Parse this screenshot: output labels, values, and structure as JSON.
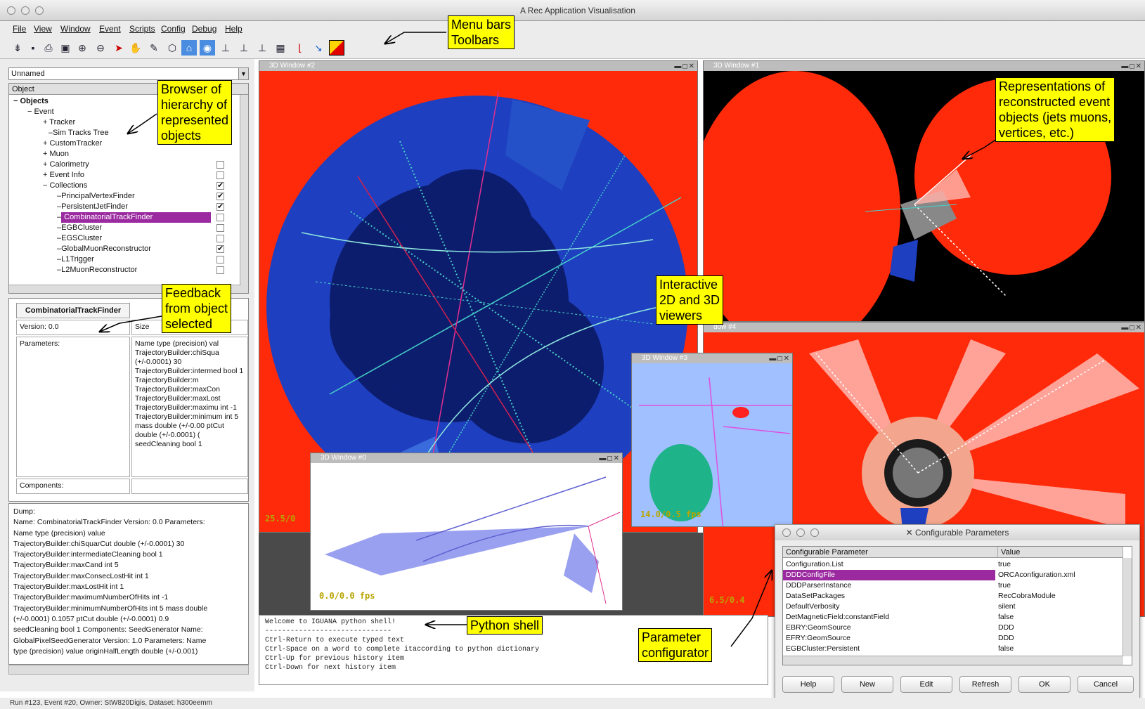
{
  "app": {
    "title": "A Rec Application Visualisation",
    "menu": [
      "File",
      "View",
      "Window",
      "Event",
      "Scripts",
      "Config",
      "Debug",
      "Help"
    ]
  },
  "toolbar_icons": [
    "step-icon",
    "save-icon",
    "print-icon",
    "print-preview-icon",
    "zoom-in-icon",
    "zoom-out-icon",
    "select-arrow-icon",
    "hand-icon",
    "pick-icon",
    "view-all-icon",
    "home-icon",
    "seek-icon",
    "xy-view-icon",
    "yz-view-icon",
    "xz-view-icon",
    "grid-icon",
    "axes-icon",
    "direction-icon",
    "color-icon"
  ],
  "browser": {
    "combo_value": "Unnamed",
    "column_header": "Object",
    "nodes": [
      {
        "label": "Objects",
        "bold": true,
        "expander": "−",
        "check": ""
      },
      {
        "label": "Event",
        "expander": "−",
        "check": ""
      },
      {
        "label": "Tracker",
        "expander": "+",
        "check": ""
      },
      {
        "label": "Sim Tracks Tree",
        "expander": "",
        "check": ""
      },
      {
        "label": "CustomTracker",
        "expander": "+",
        "check": ""
      },
      {
        "label": "Muon",
        "expander": "+",
        "check": ""
      },
      {
        "label": "Calorimetry",
        "expander": "+",
        "check": "off"
      },
      {
        "label": "Event Info",
        "expander": "+",
        "check": "off"
      },
      {
        "label": "Collections",
        "expander": "−",
        "check": "on"
      },
      {
        "label": "PrincipalVertexFinder",
        "expander": "",
        "check": "on"
      },
      {
        "label": "PersistentJetFinder",
        "expander": "",
        "check": "on"
      },
      {
        "label": "CombinatorialTrackFinder",
        "expander": "",
        "check": "off",
        "selected": true
      },
      {
        "label": "EGBCluster",
        "expander": "",
        "check": "off"
      },
      {
        "label": "EGSCluster",
        "expander": "",
        "check": "off"
      },
      {
        "label": "GlobalMuonReconstructor",
        "expander": "",
        "check": "on"
      },
      {
        "label": "L1Trigger",
        "expander": "",
        "check": "off"
      },
      {
        "label": "L2MuonReconstructor",
        "expander": "",
        "check": "off"
      }
    ]
  },
  "detail": {
    "tab": "CombinatorialTrackFinder",
    "version": "Version: 0.0",
    "size_label": "Size",
    "parameters_label": "Parameters:",
    "parameters_value": "Name type (precision) val TrajectoryBuilder:chiSqua (+/-0.0001) 30 TrajectoryBuilder:intermed bool 1 TrajectoryBuilder:m TrajectoryBuilder:maxCon TrajectoryBuilder:maxLost TrajectoryBuilder:maximu int -1 TrajectoryBuilder:minimum int 5 mass double (+/-0.00 ptCut double (+/-0.0001) ( seedCleaning bool 1",
    "components_label": "Components:"
  },
  "dump": {
    "lines": [
      "Dump:",
      "Name: CombinatorialTrackFinder Version: 0.0 Parameters:",
      "Name type (precision) value",
      "TrajectoryBuilder:chiSquarCut double (+/-0.0001) 30",
      "TrajectoryBuilder:intermediateCleaning bool 1",
      "TrajectoryBuilder:maxCand int 5",
      "TrajectoryBuilder:maxConsecLostHit int 1",
      "TrajectoryBuilder:maxLostHit int 1",
      "TrajectoryBuilder:maximumNumberOfHits int -1",
      "TrajectoryBuilder:minimumNumberOfHits int 5 mass double",
      "(+/-0.0001) 0.1057 ptCut double (+/-0.0001) 0.9",
      "seedCleaning bool 1 Components: SeedGenerator Name:",
      "GlobalPixelSeedGenerator Version: 1.0 Parameters: Name",
      "type (precision) value originHalfLength double (+/-0.001)"
    ]
  },
  "viewers": {
    "w2_title": "3D Window #2",
    "w1_title": "3D Window #1",
    "w4_title": "dow #4",
    "w3_title": "3D Window #3",
    "w0_title": "3D Window #0",
    "w2_fps": "25.5/0",
    "w3_fps": "14.0/0.5 fps",
    "w0_fps": "0.0/0.0 fps",
    "w4_fps": "6.5/0.4",
    "buttons": "▬◻✕"
  },
  "shell": {
    "lines": [
      "Welcome to IGUANA python shell!",
      "------------------------------",
      "Ctrl-Return to execute typed text",
      "Ctrl-Space on a word to complete itaccording to python dictionary",
      "Ctrl-Up for previous history item",
      "Ctrl-Down for next history item"
    ]
  },
  "dialog": {
    "title": "Configurable Parameters",
    "col_param": "Configurable Parameter",
    "col_value": "Value",
    "rows": [
      {
        "name": "Configuration.List",
        "value": "true"
      },
      {
        "name": "DDDConfigFile",
        "value": "ORCAconfiguration.xml",
        "selected": true
      },
      {
        "name": "DDDParserInstance",
        "value": "true"
      },
      {
        "name": "DataSetPackages",
        "value": "RecCobraModule"
      },
      {
        "name": "DefaultVerbosity",
        "value": "silent"
      },
      {
        "name": "DetMagneticField:constantField",
        "value": "false"
      },
      {
        "name": "EBRY:GeomSource",
        "value": "DDD"
      },
      {
        "name": "EFRY:GeomSource",
        "value": "DDD"
      },
      {
        "name": "EGBCluster:Persistent",
        "value": "false"
      }
    ],
    "buttons": [
      "Help",
      "New",
      "Edit",
      "Refresh",
      "OK",
      "Cancel"
    ]
  },
  "status": "Run #123, Event #20, Owner: StW820Digis, Dataset: h300eemm",
  "annotations": {
    "menu": "Menu bars\nToolbars",
    "browser": "Browser of\nhierarchy of\nrepresented\nobjects",
    "feedback": "Feedback\nfrom object\nselected",
    "viewers": "Interactive\n2D and 3D\nviewers",
    "representations": "Representations of\nreconstructed event\nobjects (jets muons,\nvertices, etc.)",
    "python": "Python shell",
    "parameter": "Parameter\nconfigurator"
  },
  "colors": {
    "selection": "#9b2aa0",
    "viewer_red": "#ff2a0a",
    "viewer_blue": "#1e3fbf",
    "annotation": "#ffff00"
  }
}
